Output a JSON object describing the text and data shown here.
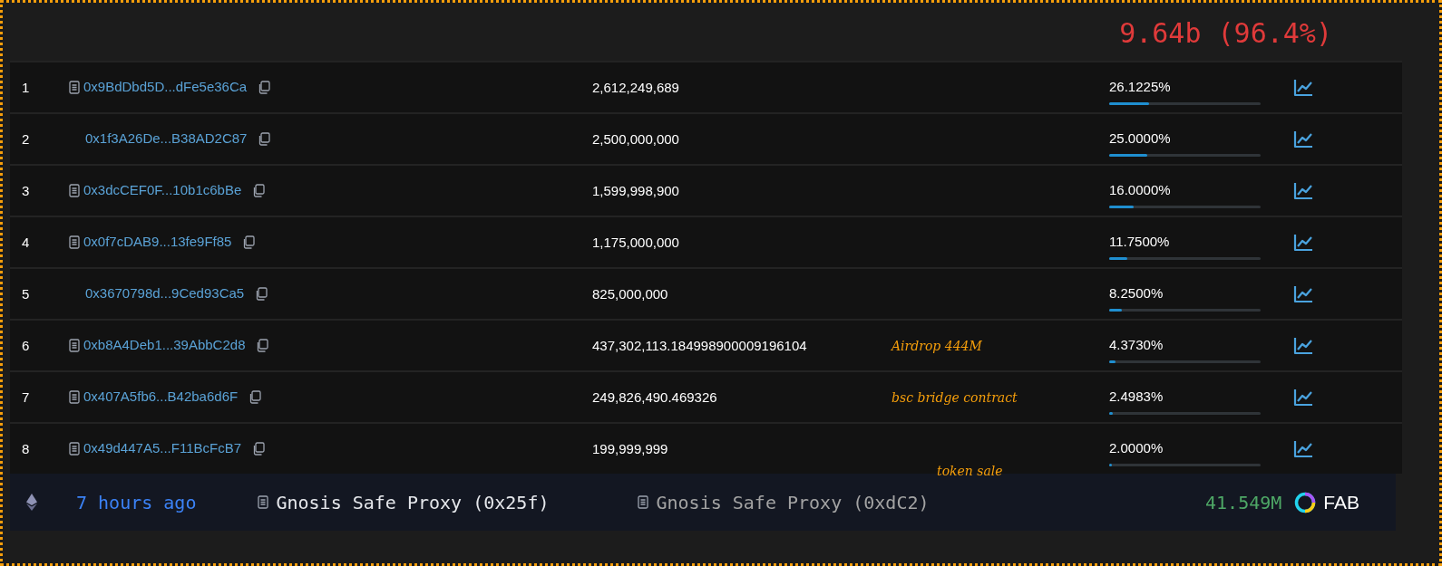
{
  "summary": "9.64b (96.4%)",
  "holders": [
    {
      "rank": "1",
      "address": "0x9BdDbd5D...dFe5e36Ca",
      "contract": true,
      "quantity": "2,612,249,689",
      "percentage": "26.1225%",
      "level": 0.261225
    },
    {
      "rank": "2",
      "address": "0x1f3A26De...B38AD2C87",
      "contract": false,
      "quantity": "2,500,000,000",
      "percentage": "25.0000%",
      "level": 0.25
    },
    {
      "rank": "3",
      "address": "0x3dcCEF0F...10b1c6bBe",
      "contract": true,
      "quantity": "1,599,998,900",
      "percentage": "16.0000%",
      "level": 0.16
    },
    {
      "rank": "4",
      "address": "0x0f7cDAB9...13fe9Ff85",
      "contract": true,
      "quantity": "1,175,000,000",
      "percentage": "11.7500%",
      "level": 0.1175
    },
    {
      "rank": "5",
      "address": "0x3670798d...9Ced93Ca5",
      "contract": false,
      "quantity": "825,000,000",
      "percentage": "8.2500%",
      "level": 0.0825
    },
    {
      "rank": "6",
      "address": "0xb8A4Deb1...39AbbC2d8",
      "contract": true,
      "quantity": "437,302,113.184998900009196104",
      "note": "Airdrop 444M",
      "percentage": "4.3730%",
      "level": 0.04373
    },
    {
      "rank": "7",
      "address": "0x407A5fb6...B42ba6d6F",
      "contract": true,
      "quantity": "249,826,490.469326",
      "note": "bsc bridge contract",
      "percentage": "2.4983%",
      "level": 0.024983
    },
    {
      "rank": "8",
      "address": "0x49d447A5...F11BcFcB7",
      "contract": true,
      "quantity": "199,999,999",
      "percentage": "2.0000%",
      "level": 0.02
    }
  ],
  "transfer": {
    "note": "token sale",
    "time": "7 hours ago",
    "from": "Gnosis Safe Proxy (0x25f)",
    "to": "Gnosis Safe Proxy (0xdC2)",
    "amount": "41.549M",
    "token": "FAB"
  }
}
